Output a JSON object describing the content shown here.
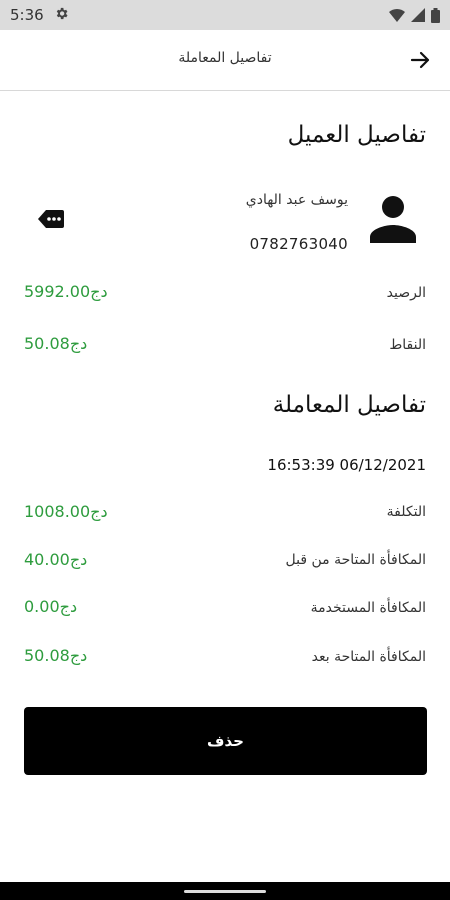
{
  "status_bar": {
    "time": "5:36"
  },
  "app_bar": {
    "title": "تفاصيل المعاملة"
  },
  "customer": {
    "section_title": "تفاصيل العميل",
    "name": "يوسف عبد الهادي",
    "phone": "0782763040",
    "balance_label": "الرصيد",
    "balance_value": "5992.00دج",
    "points_label": "النقاط",
    "points_value": "50.08دج"
  },
  "transaction": {
    "section_title": "تفاصيل المعاملة",
    "datetime": "16:53:39 06/12/2021",
    "rows": [
      {
        "label": "التكلفة",
        "value": "1008.00دج"
      },
      {
        "label": "المكافأة المتاحة من قبل",
        "value": "40.00دج"
      },
      {
        "label": "المكافأة المستخدمة",
        "value": "0.00دج"
      },
      {
        "label": "المكافأة المتاحة بعد",
        "value": "50.08دج"
      }
    ]
  },
  "actions": {
    "delete_label": "حذف"
  },
  "colors": {
    "accent_green": "#2e9c3e",
    "button_bg": "#000000"
  }
}
